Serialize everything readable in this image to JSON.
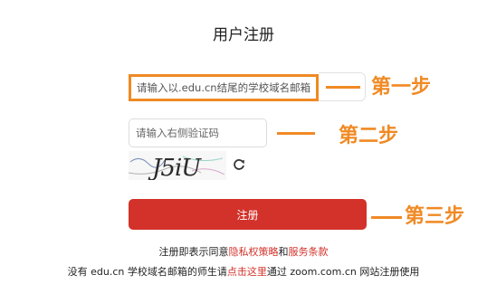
{
  "page_title": "用户注册",
  "email_field": {
    "placeholder": "请输入以.edu.cn结尾的学校域名邮箱"
  },
  "code_field": {
    "placeholder": "请输入右侧验证码"
  },
  "captcha": {
    "text": "J5iU"
  },
  "register_button": {
    "label": "注册"
  },
  "agreement": {
    "prefix": "注册即表示同意",
    "privacy_link": "隐私权策略",
    "and": "和",
    "terms_link": "服务条款"
  },
  "footer": {
    "part1": "没有 edu.cn 学校域名邮箱的师生请",
    "link": "点击这里",
    "part2": "通过 zoom.com.cn 网站注册使用"
  },
  "annotations": {
    "step1": "第一步",
    "step2": "第二步",
    "step3": "第三步"
  },
  "colors": {
    "accent_orange": "#f08a24",
    "brand_red": "#d3322b"
  },
  "icons": {
    "refresh": "refresh-icon"
  }
}
